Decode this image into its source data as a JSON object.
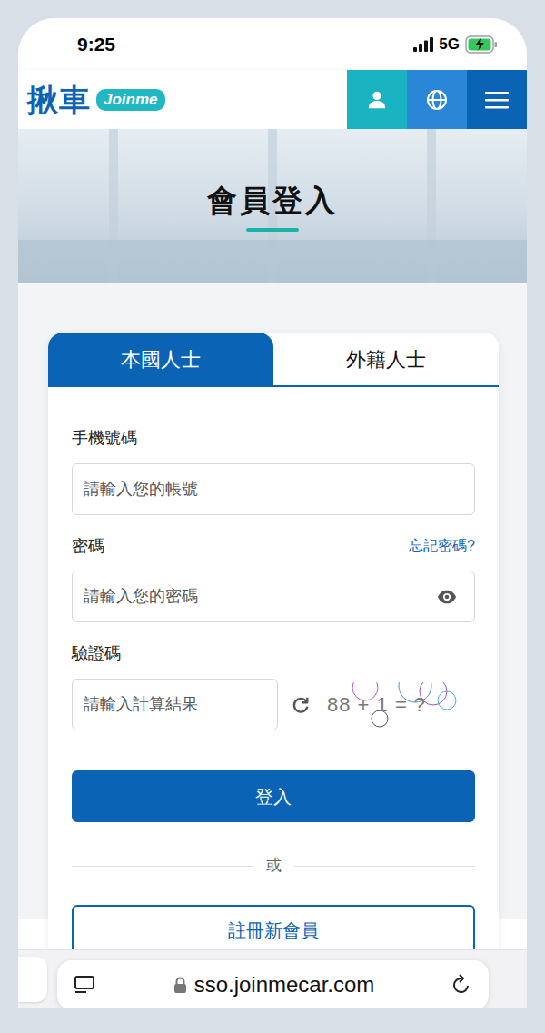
{
  "status_bar": {
    "time": "9:25",
    "network": "5G"
  },
  "header": {
    "logo": "揪車",
    "badge": "Joinme"
  },
  "banner": {
    "title": "會員登入"
  },
  "tabs": [
    {
      "label": "本國人士",
      "selected": true
    },
    {
      "label": "外籍人士",
      "selected": false
    }
  ],
  "form": {
    "phone": {
      "label": "手機號碼",
      "placeholder": "請輸入您的帳號"
    },
    "password": {
      "label": "密碼",
      "placeholder": "請輸入您的密碼",
      "forgot": "忘記密碼?"
    },
    "captcha": {
      "label": "驗證碼",
      "placeholder": "請輸入計算結果",
      "question": "88 + 1 = ?"
    }
  },
  "login_button": "登入",
  "divider": "或",
  "register_button": "註冊新會員",
  "browser": {
    "url": "sso.joinmecar.com"
  }
}
